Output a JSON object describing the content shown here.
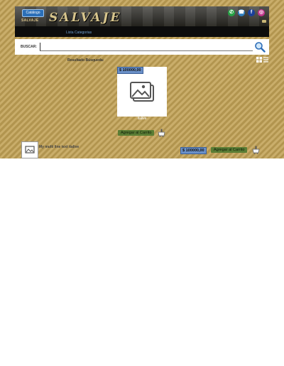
{
  "header": {
    "catalog_button": "Catálogo",
    "brand_small": "SALVAJE",
    "brand": "SALVAJE",
    "categories_link": "Lista Categorias",
    "social": [
      {
        "name": "whatsapp-icon",
        "glyph": "✆",
        "color": "#25a244"
      },
      {
        "name": "phone-icon",
        "glyph": "☎",
        "color": "#2f7fc1"
      },
      {
        "name": "facebook-icon",
        "glyph": "f",
        "color": "#1a3f9a"
      },
      {
        "name": "instagram-icon",
        "glyph": "◎",
        "color": "#c1358c"
      }
    ]
  },
  "search": {
    "label": "BUSCAR:",
    "value": "",
    "placeholder": ""
  },
  "results": {
    "label": "Resultado Búsqueda:"
  },
  "featured": {
    "price": "$ 100000,00",
    "caption": "italive",
    "add_label": "Agregar al Carrito"
  },
  "list_item": {
    "title": "My multi line text italive",
    "price": "$ 100000,00",
    "add_label": "Agregar al Carrito"
  }
}
